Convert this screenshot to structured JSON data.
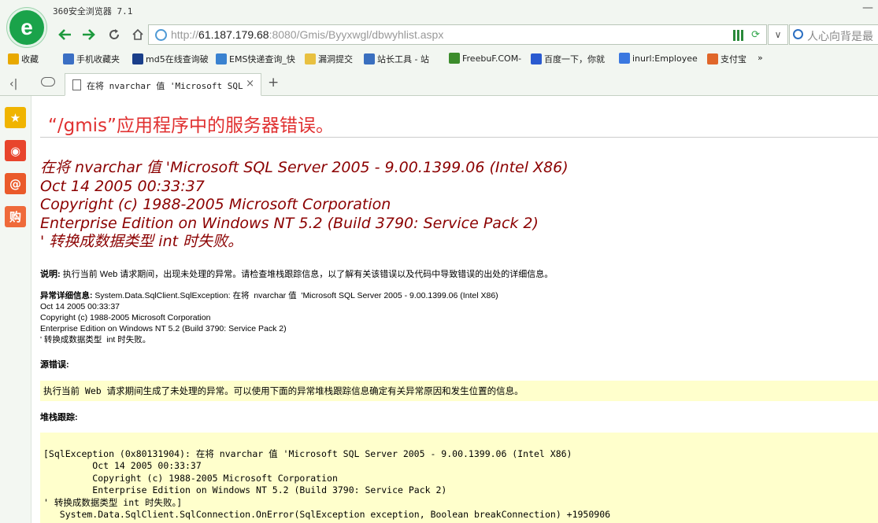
{
  "browser": {
    "app_title": "360安全浏览器 7.1",
    "url_host": "http://61.187.179.68",
    "url_host_strong": "61.187.179.68",
    "url_rest": ":8080/Gmis/Byyxwgl/dbwyhlist.aspx",
    "search_text": "人心向背是最",
    "tab_title": "在将 nvarchar 值 'Microsoft SQL Se",
    "new_tab": "+"
  },
  "favorites": [
    {
      "label": "收藏",
      "icon": "star-add-icon",
      "color": "#e8a800"
    },
    {
      "label": "手机收藏夹",
      "icon": "phone-icon",
      "color": "#3b6fc4"
    },
    {
      "label": "md5在线查询破",
      "icon": "grid-icon",
      "color": "#1a3e8a"
    },
    {
      "label": "EMS快递查询_快",
      "icon": "ems-icon",
      "color": "#3a82d0"
    },
    {
      "label": "漏洞提交",
      "icon": "folder-icon",
      "color": "#e8c040"
    },
    {
      "label": "站长工具 - 站",
      "icon": "chinaz-icon",
      "color": "#3a6fbf"
    },
    {
      "label": "FreebuF.COM-",
      "icon": "freebuf-icon",
      "color": "#3c8c2c"
    },
    {
      "label": "百度一下，你就",
      "icon": "baidu-icon",
      "color": "#2a5ad0"
    },
    {
      "label": "inurl:Employee",
      "icon": "google-icon",
      "color": "#3b78e0"
    },
    {
      "label": "支付宝",
      "icon": "alipay-shield-icon",
      "color": "#e0662a"
    },
    {
      "label": "»",
      "icon": "more-icon",
      "color": "#666"
    }
  ],
  "sidebar_icons": [
    {
      "name": "favorites-star-icon",
      "glyph": "★",
      "color": "#f0b400"
    },
    {
      "name": "weibo-icon",
      "glyph": "◉",
      "color": "#e8452c"
    },
    {
      "name": "mail-at-icon",
      "glyph": "@",
      "color": "#ea5a2a"
    },
    {
      "name": "shopping-icon",
      "glyph": "购",
      "color": "#ef6a3a"
    }
  ],
  "page": {
    "title": "“/gmis”应用程序中的服务器错误。",
    "error_lines": [
      "在将 nvarchar 值 'Microsoft SQL Server 2005 - 9.00.1399.06 (Intel X86)",
      "Oct 14 2005 00:33:37",
      "Copyright (c) 1988-2005 Microsoft Corporation",
      "Enterprise Edition on Windows NT 5.2 (Build 3790: Service Pack 2)",
      "' 转换成数据类型 int 时失败。"
    ],
    "desc_label": "说明:",
    "desc_text": " 执行当前 Web 请求期间，出现未处理的异常。请检查堆栈跟踪信息，以了解有关该错误以及代码中导致错误的出处的详细信息。",
    "exception_label": "异常详细信息:",
    "exception_lines": [
      " System.Data.SqlClient.SqlException: 在将  nvarchar 值  'Microsoft SQL Server 2005 - 9.00.1399.06 (Intel X86)",
      "Oct 14 2005 00:33:37",
      "Copyright (c) 1988-2005 Microsoft Corporation",
      "Enterprise Edition on Windows NT 5.2 (Build 3790: Service Pack 2)",
      "' 转换成数据类型  int 时失败。"
    ],
    "source_label": "源错误:",
    "source_text": "执行当前 Web 请求期间生成了未处理的异常。可以使用下面的异常堆栈跟踪信息确定有关异常原因和发生位置的信息。",
    "stack_label": "堆栈跟踪:",
    "stack_lines": [
      "[SqlException (0x80131904): 在将 nvarchar 值 'Microsoft SQL Server 2005 - 9.00.1399.06 (Intel X86)",
      "         Oct 14 2005 00:33:37",
      "         Copyright (c) 1988-2005 Microsoft Corporation",
      "         Enterprise Edition on Windows NT 5.2 (Build 3790: Service Pack 2)",
      "' 转换成数据类型 int 时失败。]",
      "   System.Data.SqlClient.SqlConnection.OnError(SqlException exception, Boolean breakConnection) +1950906"
    ]
  }
}
